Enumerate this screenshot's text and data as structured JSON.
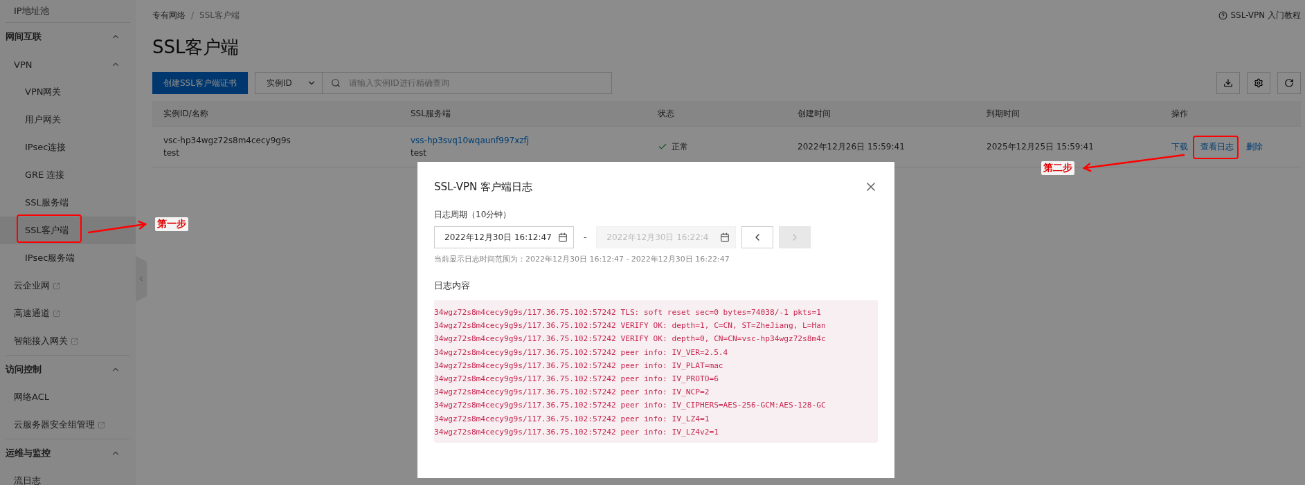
{
  "sidebar": {
    "items": [
      {
        "label": "IP地址池",
        "external": false
      }
    ],
    "groups": [
      {
        "title": "网间互联",
        "expanded": true,
        "items": [
          {
            "label": "VPN",
            "external": false,
            "expanded": true,
            "children": [
              {
                "label": "VPN网关",
                "selected": false
              },
              {
                "label": "用户网关",
                "selected": false
              },
              {
                "label": "IPsec连接",
                "selected": false
              },
              {
                "label": "GRE 连接",
                "selected": false
              },
              {
                "label": "SSL服务端",
                "selected": false
              },
              {
                "label": "SSL客户端",
                "selected": true
              },
              {
                "label": "IPsec服务端",
                "selected": false
              }
            ]
          },
          {
            "label": "云企业网",
            "external": true
          },
          {
            "label": "高速通道",
            "external": true
          },
          {
            "label": "智能接入网关",
            "external": true
          }
        ]
      },
      {
        "title": "访问控制",
        "expanded": true,
        "items": [
          {
            "label": "网络ACL",
            "external": false
          },
          {
            "label": "云服务器安全组管理",
            "external": true
          }
        ]
      },
      {
        "title": "运维与监控",
        "expanded": true,
        "items": [
          {
            "label": "流日志",
            "external": false
          }
        ]
      }
    ]
  },
  "breadcrumb": [
    "专有网络",
    "SSL客户端"
  ],
  "breadcrumb_separator": "/",
  "help_link": "SSL-VPN 入门教程",
  "title": "SSL客户端",
  "toolbar": {
    "create_button": "创建SSL客户端证书",
    "filter_select": "实例ID",
    "search": {
      "placeholder": "请输入实例ID进行精确查询"
    }
  },
  "table": {
    "columns": [
      "实例ID/名称",
      "SSL服务端",
      "状态",
      "创建时间",
      "到期时间",
      "操作"
    ],
    "rows": [
      {
        "id": "vsc-hp34wgz72s8m4cecy9g9s",
        "name": "test",
        "server_id": "vss-hp3svq10wqaunf997xzfj",
        "server_name": "test",
        "status": "正常",
        "created": "2022年12月26日 15:59:41",
        "expires": "2025年12月25日 15:59:41",
        "actions": [
          "下载",
          "查看日志",
          "删除"
        ]
      }
    ]
  },
  "modal": {
    "title": "SSL-VPN 客户端日志",
    "period_label": "日志周期（10分钟）",
    "start": {
      "value": "2022年12月30日 16:12:47",
      "disabled": false
    },
    "range_separator": "-",
    "end": {
      "value": "2022年12月30日 16:22:4",
      "disabled": true
    },
    "prev": {
      "disabled": false
    },
    "next": {
      "disabled": true
    },
    "range_text": "当前显示日志时间范围为：2022年12月30日 16:12:47 - 2022年12月30日 16:22:47",
    "content_label": "日志内容",
    "log_lines": [
      "34wgz72s8m4cecy9g9s/117.36.75.102:57242 TLS: soft reset sec=0 bytes=74038/-1 pkts=1",
      "34wgz72s8m4cecy9g9s/117.36.75.102:57242 VERIFY OK: depth=1, C=CN, ST=ZheJiang, L=Han",
      "34wgz72s8m4cecy9g9s/117.36.75.102:57242 VERIFY OK: depth=0, CN=CN=vsc-hp34wgz72s8m4c",
      "34wgz72s8m4cecy9g9s/117.36.75.102:57242 peer info: IV_VER=2.5.4",
      "34wgz72s8m4cecy9g9s/117.36.75.102:57242 peer info: IV_PLAT=mac",
      "34wgz72s8m4cecy9g9s/117.36.75.102:57242 peer info: IV_PROTO=6",
      "34wgz72s8m4cecy9g9s/117.36.75.102:57242 peer info: IV_NCP=2",
      "34wgz72s8m4cecy9g9s/117.36.75.102:57242 peer info: IV_CIPHERS=AES-256-GCM:AES-128-GC",
      "34wgz72s8m4cecy9g9s/117.36.75.102:57242 peer info: IV_LZ4=1",
      "34wgz72s8m4cecy9g9s/117.36.75.102:57242 peer info: IV_LZ4v2=1"
    ]
  },
  "annotations": [
    {
      "label": "第一步"
    },
    {
      "label": "第二步"
    }
  ]
}
